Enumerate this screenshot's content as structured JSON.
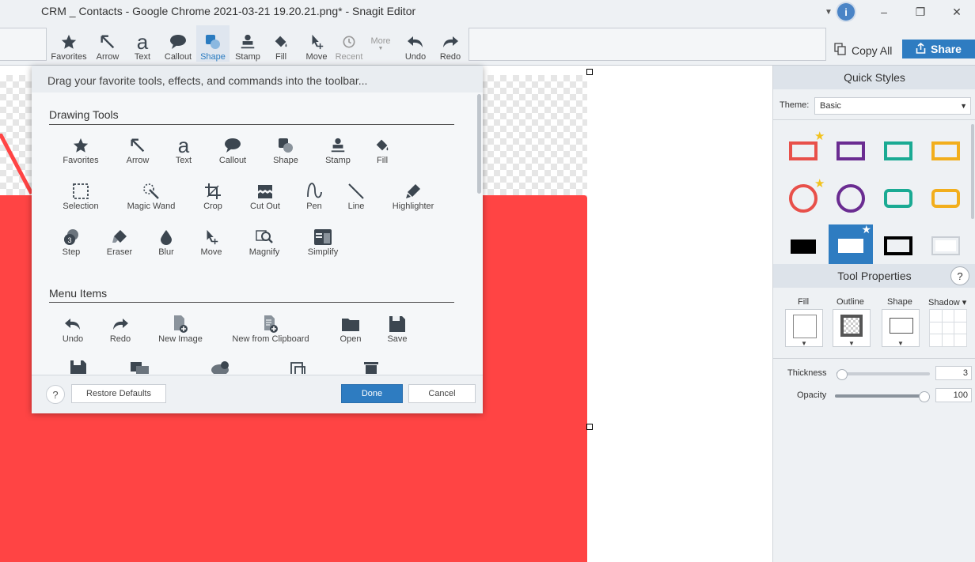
{
  "window": {
    "title": "CRM _ Contacts - Google Chrome 2021-03-21 19.20.21.png* - Snagit Editor",
    "info_label": "i",
    "controls": [
      "–",
      "❐",
      "✕"
    ]
  },
  "toolbar": {
    "tools": [
      "Favorites",
      "Arrow",
      "Text",
      "Callout",
      "Shape",
      "Stamp",
      "Fill",
      "Move",
      "Recent",
      "More",
      "Undo",
      "Redo"
    ],
    "active_tool": "Shape",
    "copy_all": "Copy All",
    "share": "Share"
  },
  "dialog": {
    "header": "Drag your favorite tools, effects, and commands into the toolbar...",
    "drawing_tools_title": "Drawing Tools",
    "drawing_tools": [
      "Favorites",
      "Arrow",
      "Text",
      "Callout",
      "Shape",
      "Stamp",
      "Fill",
      "Selection",
      "Magic Wand",
      "Crop",
      "Cut Out",
      "Pen",
      "Line",
      "Highlighter",
      "Step",
      "Eraser",
      "Blur",
      "Move",
      "Magnify",
      "Simplify"
    ],
    "menu_items_title": "Menu Items",
    "menu_items": [
      "Undo",
      "Redo",
      "New Image",
      "New from Clipboard",
      "Open",
      "Save"
    ],
    "help_label": "?",
    "restore_defaults": "Restore Defaults",
    "done": "Done",
    "cancel": "Cancel"
  },
  "quick_styles": {
    "title": "Quick Styles",
    "theme_label": "Theme:",
    "theme_value": "Basic",
    "colors": {
      "red": "#e8504a",
      "purple": "#6a2c91",
      "teal": "#1aaa93",
      "yellow": "#f2ae1c",
      "black": "#000000",
      "selected_bg": "#2e7cc1"
    }
  },
  "tool_properties": {
    "title": "Tool Properties",
    "help_label": "?",
    "fill": "Fill",
    "outline": "Outline",
    "shape": "Shape",
    "shadow": "Shadow ▾",
    "thickness_label": "Thickness",
    "thickness_value": "3",
    "thickness_level": 0.02,
    "opacity_label": "Opacity",
    "opacity_value": "100",
    "opacity_level": 1.0
  },
  "canvas": {
    "shape_color": "#ff4444"
  }
}
